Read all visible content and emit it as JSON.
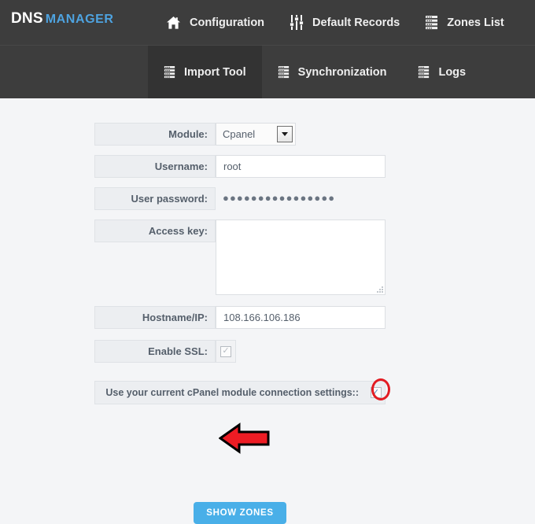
{
  "brand": {
    "primary": "DNS",
    "secondary": "MANAGER"
  },
  "nav": {
    "primary": [
      {
        "label": "Configuration",
        "icon": "home-icon"
      },
      {
        "label": "Default Records",
        "icon": "sliders-icon"
      },
      {
        "label": "Zones List",
        "icon": "server-stack-icon"
      }
    ],
    "secondary": [
      {
        "label": "Import Tool",
        "icon": "server-stack-icon",
        "active": true
      },
      {
        "label": "Synchronization",
        "icon": "server-stack-icon",
        "active": false
      },
      {
        "label": "Logs",
        "icon": "server-stack-icon",
        "active": false
      }
    ]
  },
  "form": {
    "module": {
      "label": "Module:",
      "value": "Cpanel",
      "options": [
        "Cpanel"
      ]
    },
    "username": {
      "label": "Username:",
      "value": "root",
      "placeholder": ""
    },
    "password": {
      "label": "User password:",
      "value": "●●●●●●●●●●●●●●●●"
    },
    "access_key": {
      "label": "Access key:",
      "value": "",
      "placeholder": ""
    },
    "hostname": {
      "label": "Hostname/IP:",
      "value": "108.166.106.186",
      "placeholder": ""
    },
    "enable_ssl": {
      "label": "Enable SSL:",
      "checked": true,
      "glyph": "✓"
    },
    "use_current": {
      "label": "Use your current cPanel module connection settings::",
      "checked": true,
      "glyph": "✓"
    },
    "submit": {
      "label": "SHOW ZONES"
    }
  },
  "colors": {
    "navbar": "#3d3d3d",
    "active_tab": "#333333",
    "brand_accent": "#4ea3e0",
    "page_bg": "#f4f5f7",
    "button": "#49afe8",
    "annotation": "#e21b22"
  },
  "annotations": {
    "circle": "red-ellipse-highlight-checkbox",
    "arrow": "red-left-arrow-pointing-at-button"
  }
}
